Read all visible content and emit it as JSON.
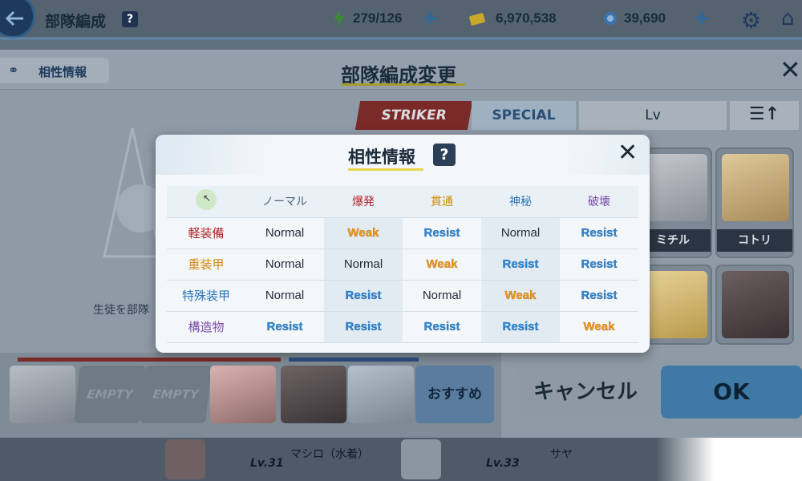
{
  "topbar": {
    "title": "部隊編成",
    "help": "?",
    "ap": "279/126",
    "credits": "6,970,538",
    "pyroxene": "39,690",
    "plus": "+"
  },
  "background": {
    "affinity_link": "相性情報",
    "title": "部隊編成変更",
    "close": "✕",
    "tabs": {
      "striker": "STRIKER",
      "special": "SPECIAL"
    },
    "sort_label": "Lv",
    "sort_dir": "☰↑",
    "cards": [
      {
        "name": "ミチル"
      },
      {
        "name": "コトリ"
      },
      {
        "name": ""
      },
      {
        "name": ""
      }
    ],
    "hint_text": "生徒を部隊",
    "slots": {
      "empty_label": "EMPTY"
    },
    "recommend": "おすすめ",
    "cancel": "キャンセル",
    "ok": "OK",
    "bottom_list": [
      {
        "level": "Lv.31",
        "name": "マシロ（水着）"
      },
      {
        "level": "Lv.33",
        "name": "サヤ"
      }
    ]
  },
  "modal": {
    "title": "相性情報",
    "help": "?",
    "close": "✕",
    "columns": [
      {
        "label": "ノーマル",
        "color": "#4d6276"
      },
      {
        "label": "爆発",
        "color": "#b2262a"
      },
      {
        "label": "貫通",
        "color": "#d18a0c"
      },
      {
        "label": "神秘",
        "color": "#2a74b8"
      },
      {
        "label": "破壊",
        "color": "#7a4aa8"
      }
    ],
    "rows": [
      {
        "label": "軽装備",
        "color": "#b2262a",
        "cells": [
          "Normal",
          "Weak",
          "Resist",
          "Normal",
          "Resist"
        ]
      },
      {
        "label": "重装甲",
        "color": "#d18a0c",
        "cells": [
          "Normal",
          "Normal",
          "Weak",
          "Resist",
          "Resist"
        ]
      },
      {
        "label": "特殊装甲",
        "color": "#2a74b8",
        "cells": [
          "Normal",
          "Resist",
          "Normal",
          "Weak",
          "Resist"
        ]
      },
      {
        "label": "構造物",
        "color": "#7a4aa8",
        "cells": [
          "Resist",
          "Resist",
          "Resist",
          "Resist",
          "Weak"
        ]
      }
    ]
  }
}
